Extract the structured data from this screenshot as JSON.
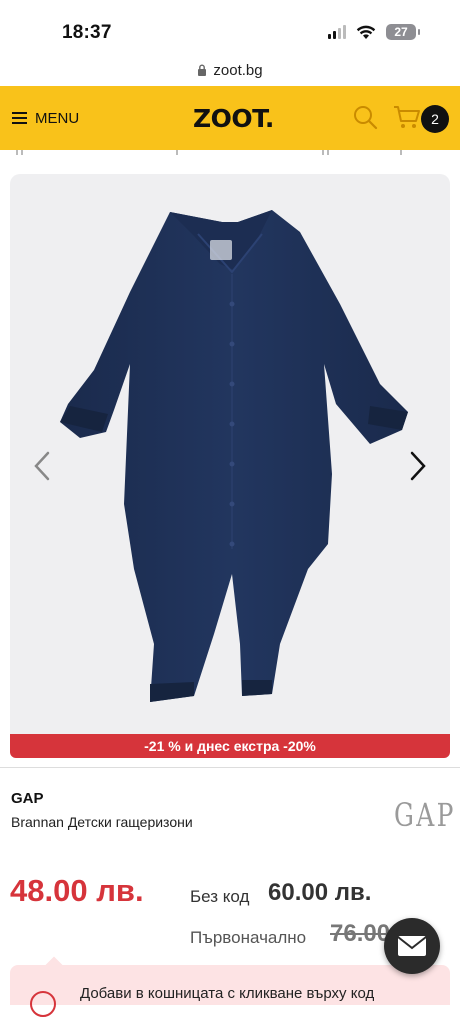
{
  "status_bar": {
    "time": "18:37",
    "battery": "27"
  },
  "browser": {
    "url": "zoot.bg"
  },
  "header": {
    "menu_label": "MENU",
    "logo": "ZOOT.",
    "cart_count": "2",
    "accent": "#f9c21a"
  },
  "gallery": {
    "image": "navy-baby-romper",
    "prev_icon": "chevron-left-icon",
    "next_icon": "chevron-right-icon"
  },
  "product": {
    "discount_text": "-21 % и днес екстра -20%",
    "brand": "GAP",
    "name": "Brannan Детски гащеризони",
    "brand_logo": "GAP",
    "price": "48.00 лв.",
    "no_code_label": "Без код",
    "no_code_price": "60.00 лв.",
    "original_label": "Първоначално",
    "original_price": "76.00 лв."
  },
  "promo": {
    "text": "Добави в кошницата с кликване върху код"
  },
  "colors": {
    "sale_red": "#d6343b",
    "promo_bg": "#fde3e4",
    "navy": "#1e2f56"
  }
}
